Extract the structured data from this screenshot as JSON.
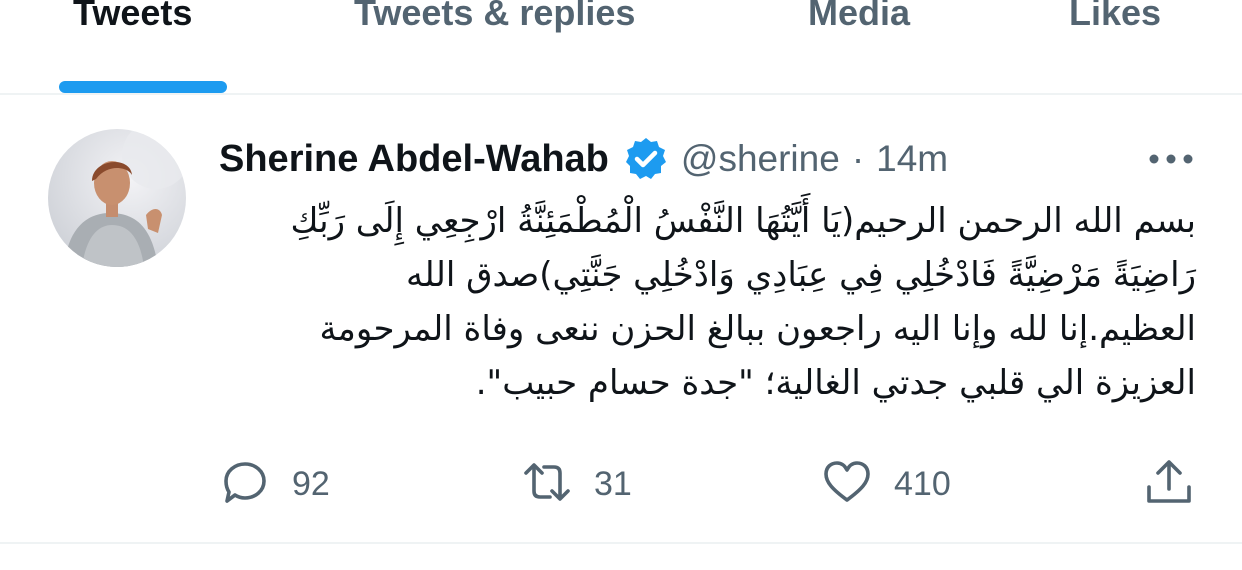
{
  "tabs": [
    {
      "label": "Tweets",
      "active": true
    },
    {
      "label": "Tweets & replies",
      "active": false
    },
    {
      "label": "Media",
      "active": false
    },
    {
      "label": "Likes",
      "active": false
    }
  ],
  "tweet": {
    "author_name": "Sherine Abdel-Wahab",
    "verified": true,
    "handle": "@sherine",
    "separator": "·",
    "time": "14m",
    "text_lines": [
      "بسم الله الرحمن الرحيم(يَا أَيَّتُهَا النَّفْسُ الْمُطْمَئِنَّةُ ارْجِعِي إِلَى رَبِّكِ",
      "رَاضِيَةً مَرْضِيَّةً فَادْخُلِي فِي عِبَادِي وَادْخُلِي جَنَّتِي)صدق الله",
      "العظيم.إنا لله وإنا اليه راجعون ببالغ الحزن ننعى وفاة المرحومة",
      "العزيزة الي قلبي جدتي الغالية؛ \"جدة حسام حبيب\"."
    ],
    "replies": "92",
    "retweets": "31",
    "likes": "410"
  },
  "icons": {
    "verified": "verified-badge-icon",
    "more": "more-horizontal-icon",
    "reply": "reply-icon",
    "retweet": "retweet-icon",
    "like": "heart-icon",
    "share": "share-icon"
  },
  "colors": {
    "accent": "#1d9bf0",
    "text_primary": "#0f1419",
    "text_secondary": "#536471",
    "divider": "#eff3f4"
  }
}
